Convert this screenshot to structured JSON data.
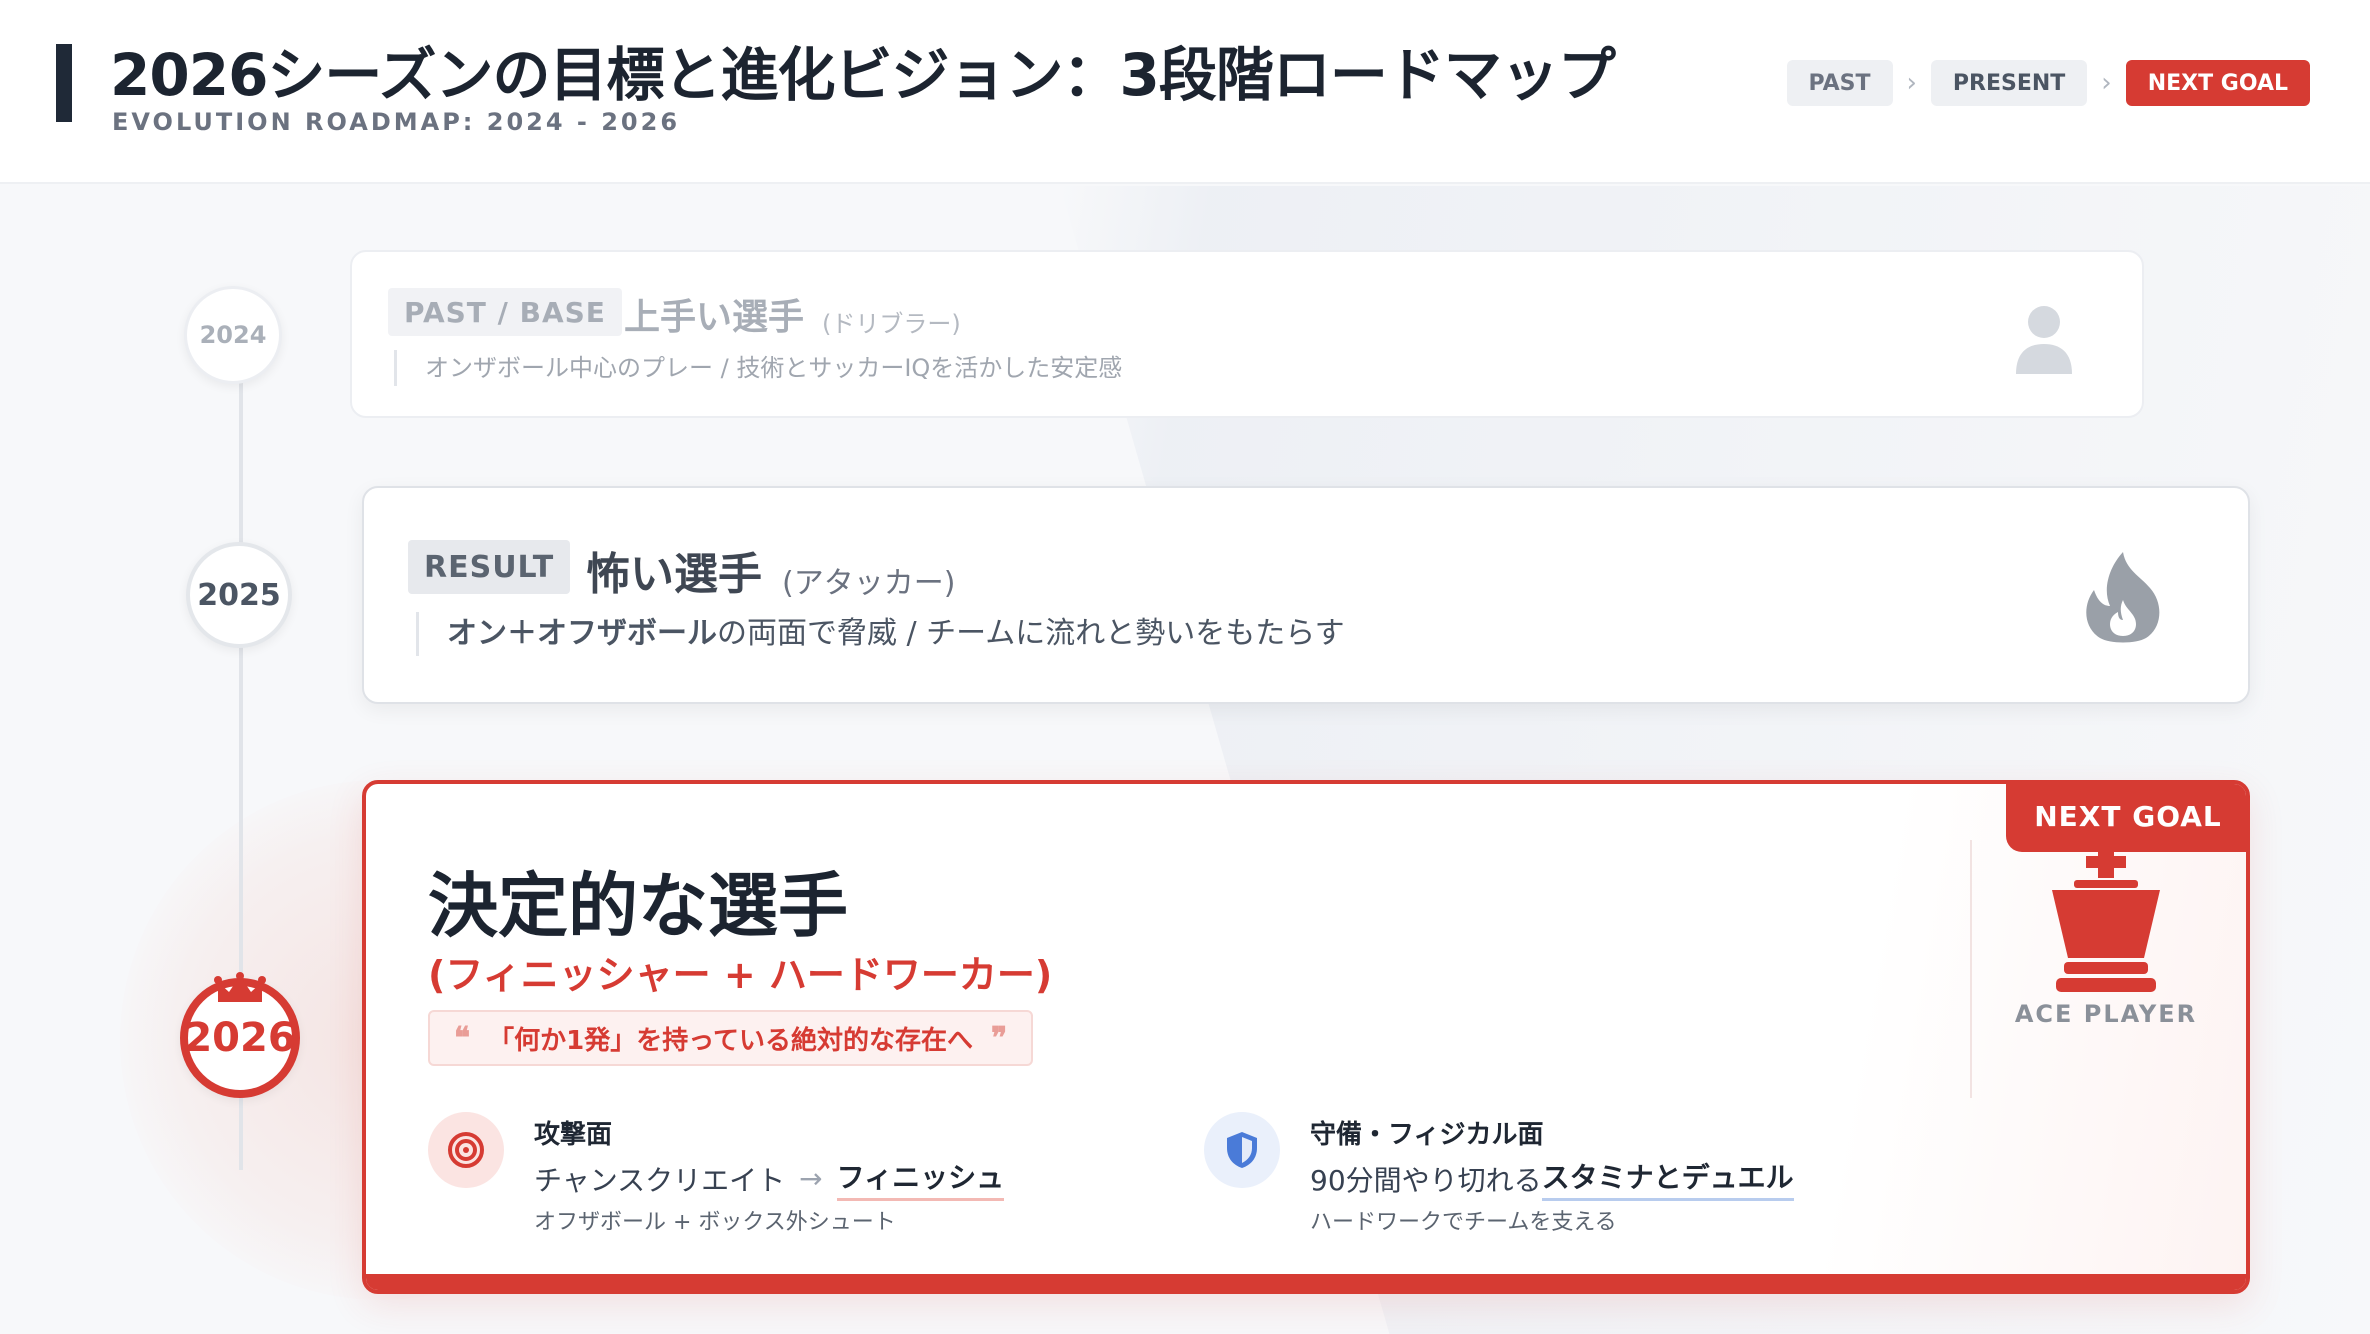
{
  "header": {
    "title": "2026シーズンの目標と進化ビジョン：3段階ロードマップ",
    "subtitle": "EVOLUTION ROADMAP: 2024 - 2026",
    "nav": [
      "PAST",
      "PRESENT",
      "NEXT GOAL"
    ]
  },
  "timeline": [
    "2024",
    "2025",
    "2026"
  ],
  "stage_past": {
    "tag": "PAST / BASE",
    "name": "上手い選手",
    "type": "(ドリブラー)",
    "desc": "オンザボール中心のプレー / 技術とサッカーIQを活かした安定感",
    "icon": "user-icon"
  },
  "stage_result": {
    "tag": "RESULT",
    "name": "怖い選手",
    "type": "(アタッカー)",
    "desc_bold": "オン＋オフザボール",
    "desc_rest": "の両面で脅威 / チームに流れと勢いをもたらす",
    "icon": "fire-icon"
  },
  "stage_goal": {
    "badge": "NEXT GOAL",
    "name": "決定的な選手",
    "type": "(フィニッシャー + ハードワーカー)",
    "quote": "「何か1発」を持っている絶対的な存在へ",
    "attack": {
      "title": "攻撃面",
      "from": "チャンスクリエイト",
      "to": "フィニッシュ",
      "note": "オフザボール + ボックス外シュート",
      "icon": "target-icon"
    },
    "defense": {
      "title": "守備・フィジカル面",
      "lead": "90分間やり切れる",
      "highlight": "スタミナとデュエル",
      "note": "ハードワークでチームを支える",
      "icon": "shield-icon"
    },
    "ace_label": "ACE PLAYER",
    "ace_icon": "chess-king-icon"
  },
  "colors": {
    "accent": "#d63b33",
    "dark": "#1c2430",
    "muted": "#9ca3af",
    "blue": "#4a7bd8"
  }
}
